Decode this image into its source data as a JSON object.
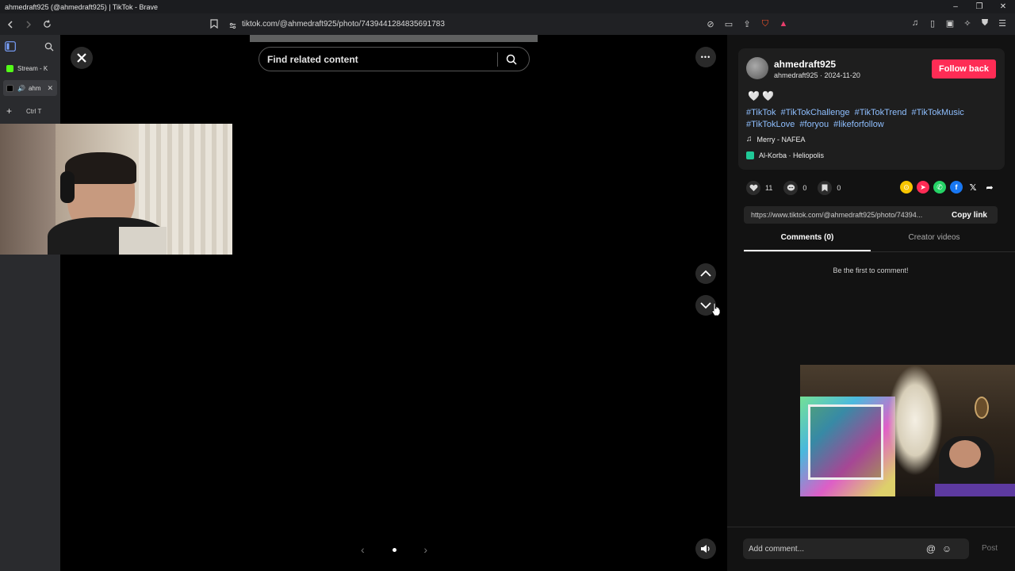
{
  "window": {
    "title": "ahmedraft925 (@ahmedraft925) | TikTok - Brave",
    "controls": {
      "minimize": "–",
      "restore": "❐",
      "close": "✕"
    }
  },
  "address_bar": {
    "url": "tiktok.com/@ahmedraft925/photo/7439441284835691783"
  },
  "sidebar": {
    "tabs": [
      {
        "label": "Stream - K",
        "favicon_color": "#53fc18"
      },
      {
        "label": "ahm",
        "favicon_color": "#111111"
      }
    ],
    "new_tab_label": "+",
    "new_tab_shortcut": "Ctrl T"
  },
  "viewer": {
    "search_placeholder": "Find related content",
    "close_icon": "✕",
    "more_icon": "•••",
    "up_icon": "⌃",
    "down_icon": "⌄",
    "pager_prev": "‹",
    "pager_next": "›",
    "volume_icon": "🔊"
  },
  "post": {
    "username": "ahmedraft925",
    "subline": "ahmedraft925 · 2024-11-20",
    "follow_label": "Follow back",
    "hearts": "🤍 🤍",
    "hashtags": [
      "#TikTok",
      "#TikTokChallenge",
      "#TikTokTrend",
      "#TikTokMusic",
      "#TikTokLove",
      "#foryou",
      "#likeforfollow"
    ],
    "music": "Merry - NAFEA",
    "location": "Al-Korba · Heliopolis",
    "likes": "11",
    "comments": "0",
    "saves": "0",
    "link": "https://www.tiktok.com/@ahmedraft925/photo/74394...",
    "copy_label": "Copy link",
    "tabs": [
      {
        "label": "Comments (0)",
        "active": true
      },
      {
        "label": "Creator videos",
        "active": false
      }
    ],
    "empty_comments": "Be the first to comment!",
    "comment_placeholder": "Add comment...",
    "post_label": "Post"
  },
  "colors": {
    "accent": "#fe2c55",
    "hashtag": "#8fbfff"
  }
}
